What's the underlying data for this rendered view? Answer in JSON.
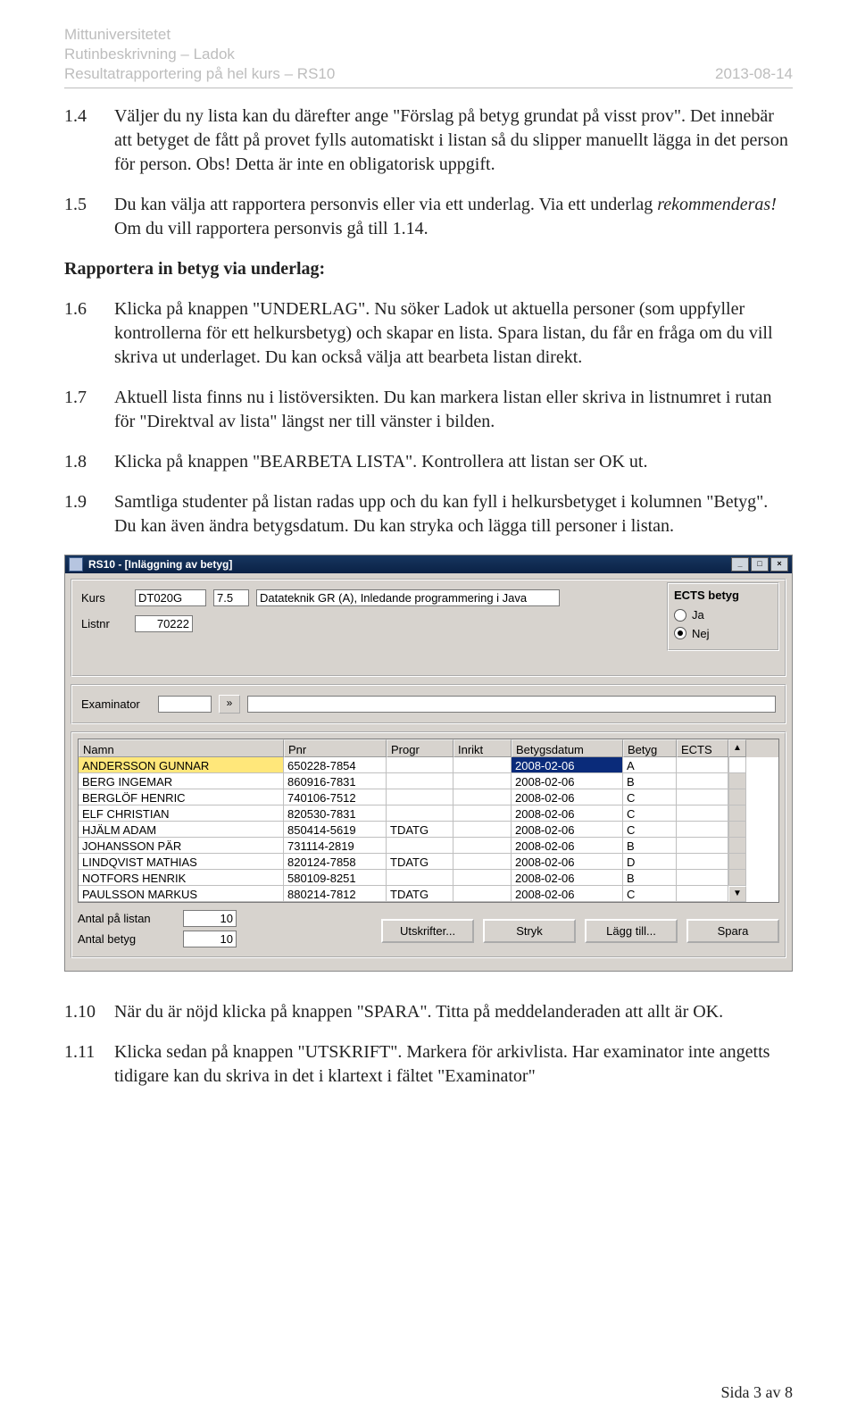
{
  "header": {
    "l1": "Mittuniversitetet",
    "l2": "Rutinbeskrivning – Ladok",
    "l3": "Resultatrapportering på hel kurs – RS10",
    "date": "2013-08-14"
  },
  "para": {
    "p14n": "1.4",
    "p14": "Väljer du ny lista kan du därefter ange \"Förslag på betyg grundat på visst prov\". Det innebär att betyget de fått på provet fylls automatiskt i listan så du slipper manuellt lägga in det person för person. Obs! Detta är inte en obligatorisk uppgift.",
    "p15n": "1.5",
    "p15a": "Du kan välja att rapportera personvis eller via ett underlag. Via ett underlag ",
    "p15em": "rekommenderas!",
    "p15b": " Om du vill rapportera personvis gå till 1.14.",
    "h2": "Rapportera in betyg via underlag:",
    "p16n": "1.6",
    "p16": "Klicka på knappen \"UNDERLAG\". Nu söker Ladok ut aktuella personer (som uppfyller kontrollerna för ett helkursbetyg) och skapar en lista. Spara listan, du får en fråga om du vill skriva ut underlaget. Du kan också välja att bearbeta listan direkt.",
    "p17n": "1.7",
    "p17": "Aktuell lista finns nu i listöversikten. Du kan markera listan eller skriva in listnumret i rutan för \"Direktval av lista\" längst ner till vänster i bilden.",
    "p18n": "1.8",
    "p18": "Klicka på knappen \"BEARBETA LISTA\". Kontrollera att listan ser OK ut.",
    "p19n": "1.9",
    "p19": "Samtliga studenter på listan radas upp och du kan fyll i helkursbetyget i kolumnen \"Betyg\". Du kan även ändra betygsdatum. Du kan stryka och lägga till personer i listan.",
    "p110n": "1.10",
    "p110": "När du är nöjd klicka på knappen \"SPARA\". Titta på meddelanderaden att allt är OK.",
    "p111n": "1.11",
    "p111": "Klicka sedan på knappen \"UTSKRIFT\". Markera för arkivlista. Har examinator inte angetts tidigare kan du skriva in det i klartext i fältet \"Examinator\""
  },
  "pagenum": "Sida 3 av 8",
  "shot": {
    "title": "RS10 - [Inläggning av betyg]",
    "labels": {
      "kurs": "Kurs",
      "listnr": "Listnr",
      "exam": "Examinator",
      "ectsCap": "ECTS betyg",
      "ja": "Ja",
      "nej": "Nej",
      "antalLista": "Antal på listan",
      "antalBetyg": "Antal betyg"
    },
    "kursCode": "DT020G",
    "kursHp": "7.5",
    "kursName": "Datateknik GR (A), Inledande programmering i Java",
    "listnr": "70222",
    "ectsSel": "nej",
    "antalLista": "10",
    "antalBetyg": "10",
    "cols": {
      "c0": "Namn",
      "c1": "Pnr",
      "c2": "Progr",
      "c3": "Inrikt",
      "c4": "Betygsdatum",
      "c5": "Betyg",
      "c6": "ECTS"
    },
    "rows": [
      {
        "n": "ANDERSSON GUNNAR",
        "p": "650228-7854",
        "prog": "",
        "in": "",
        "d": "2008-02-06",
        "b": "A",
        "e": ""
      },
      {
        "n": "BERG INGEMAR",
        "p": "860916-7831",
        "prog": "",
        "in": "",
        "d": "2008-02-06",
        "b": "B",
        "e": ""
      },
      {
        "n": "BERGLÖF HENRIC",
        "p": "740106-7512",
        "prog": "",
        "in": "",
        "d": "2008-02-06",
        "b": "C",
        "e": ""
      },
      {
        "n": "ELF CHRISTIAN",
        "p": "820530-7831",
        "prog": "",
        "in": "",
        "d": "2008-02-06",
        "b": "C",
        "e": ""
      },
      {
        "n": "HJÄLM ADAM",
        "p": "850414-5619",
        "prog": "TDATG",
        "in": "",
        "d": "2008-02-06",
        "b": "C",
        "e": ""
      },
      {
        "n": "JOHANSSON PÄR",
        "p": "731114-2819",
        "prog": "",
        "in": "",
        "d": "2008-02-06",
        "b": "B",
        "e": ""
      },
      {
        "n": "LINDQVIST MATHIAS",
        "p": "820124-7858",
        "prog": "TDATG",
        "in": "",
        "d": "2008-02-06",
        "b": "D",
        "e": ""
      },
      {
        "n": "NOTFORS HENRIK",
        "p": "580109-8251",
        "prog": "",
        "in": "",
        "d": "2008-02-06",
        "b": "B",
        "e": ""
      },
      {
        "n": "PAULSSON MARKUS",
        "p": "880214-7812",
        "prog": "TDATG",
        "in": "",
        "d": "2008-02-06",
        "b": "C",
        "e": ""
      }
    ],
    "btns": {
      "utskrift": "Utskrifter...",
      "stryk": "Stryk",
      "lagg": "Lägg till...",
      "spara": "Spara"
    }
  }
}
